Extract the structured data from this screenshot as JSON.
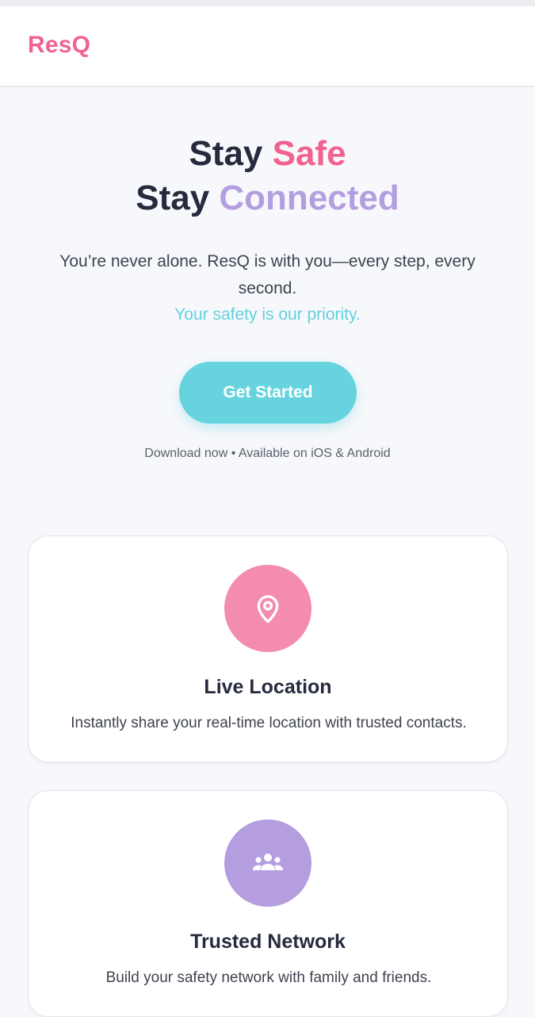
{
  "header": {
    "logo": "ResQ"
  },
  "hero": {
    "line1_prefix": "Stay ",
    "line1_accent": "Safe",
    "line2_prefix": "Stay ",
    "line2_accent": "Connected",
    "subtitle": "You’re never alone. ResQ is with you—every step, every second.",
    "priority": "Your safety is our priority.",
    "cta_label": "Get Started",
    "download_note": "Download now • Available on iOS & Android"
  },
  "features": [
    {
      "icon": "map-pin-icon",
      "title": "Live Location",
      "description": "Instantly share your real-time location with trusted contacts."
    },
    {
      "icon": "people-group-icon",
      "title": "Trusted Network",
      "description": "Build your safety network with family and friends."
    }
  ],
  "colors": {
    "brand_pink": "#f0628f",
    "accent_purple": "#b49ee0",
    "accent_teal": "#66d3df",
    "text_dark": "#262a3d"
  }
}
